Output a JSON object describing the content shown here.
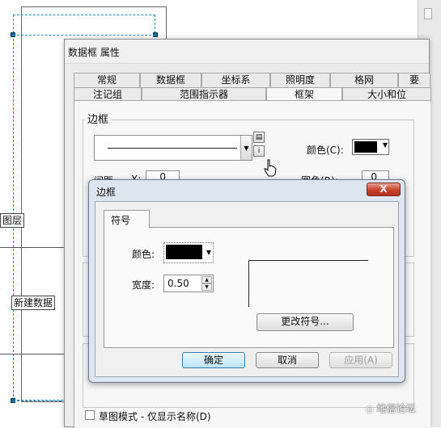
{
  "background": {
    "layer_label": "图层",
    "new_frame_label": "新建数据"
  },
  "main_dialog": {
    "title": "数据框 属性",
    "tabs_row1": [
      "常规",
      "数据框",
      "坐标系",
      "照明度",
      "格网",
      "要"
    ],
    "tabs_row2": [
      "注记组",
      "范围指示器",
      "框架",
      "大小和位"
    ],
    "active_tab": "框架",
    "border_group_label": "边框",
    "border_color_label": "颜色(C):",
    "gap_label_partial": "间距",
    "gap_x_label": "X:",
    "gap_x_value": "0",
    "round_label": "圆角(R):",
    "round_value": "0",
    "draft_mode_label": "草图模式 - 仅显示名称(D)"
  },
  "sub_dialog": {
    "title": "边框",
    "close_label": "X",
    "tab_label": "符号",
    "color_label": "颜色:",
    "width_label": "宽度:",
    "width_value": "0.50",
    "change_symbol_label": "更改符号...",
    "ok_label": "确定",
    "cancel_label": "取消",
    "apply_label": "应用(A)"
  },
  "watermark": "地信论坛",
  "colors": {
    "border_color": "#000000",
    "selection_dash": "#2a88b8",
    "close_red": "#c8432b"
  }
}
